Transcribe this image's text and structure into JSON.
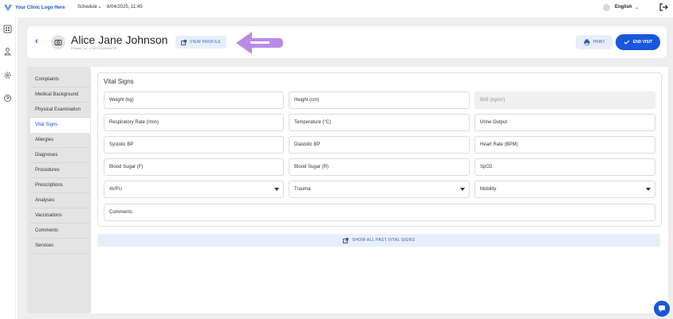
{
  "topbar": {
    "logo_text": "Your Clinic Logo Here",
    "schedule_label": "Schedule",
    "datetime": "8/04/2025, 11:45",
    "language": "English"
  },
  "header": {
    "patient_name": "Alice Jane Johnson",
    "patient_meta": "Female, 34, 1739171153686-TR",
    "view_profile_label": "VIEW PROFILE",
    "print_label": "PRINT",
    "end_visit_label": "END VISIT"
  },
  "sidenav": {
    "items": [
      {
        "label": "Complaints"
      },
      {
        "label": "Medical Background"
      },
      {
        "label": "Physical Examination"
      },
      {
        "label": "Vital Signs"
      },
      {
        "label": "Allergies"
      },
      {
        "label": "Diagnoses"
      },
      {
        "label": "Procedures"
      },
      {
        "label": "Prescriptions"
      },
      {
        "label": "Analyses"
      },
      {
        "label": "Vaccinations"
      },
      {
        "label": "Comments"
      },
      {
        "label": "Services"
      }
    ],
    "active": "Vital Signs"
  },
  "vitals": {
    "title": "Vital Signs",
    "fields": {
      "weight": "Weight (kg)",
      "height": "Height (cm)",
      "bmi": "BMI (kg/m²)",
      "respiratory_rate": "Respiratory Rate (/min)",
      "temperature": "Temperature (°C)",
      "urine_output": "Urine Output",
      "systolic_bp": "Systolic BP",
      "diastolic_bp": "Diastolic BP",
      "heart_rate": "Heart Rate (BPM)",
      "blood_sugar_f": "Blood Sugar (F)",
      "blood_sugar_r": "Blood Sugar (R)",
      "spo2": "SpO2",
      "avpu": "AVPU",
      "trauma": "Trauma",
      "mobility": "Mobility",
      "comments": "Comments"
    },
    "show_past_label": "SHOW ALL PAST VITAL SIGNS"
  },
  "colors": {
    "accent": "#1a56db",
    "annotation_arrow": "#b98be8"
  }
}
